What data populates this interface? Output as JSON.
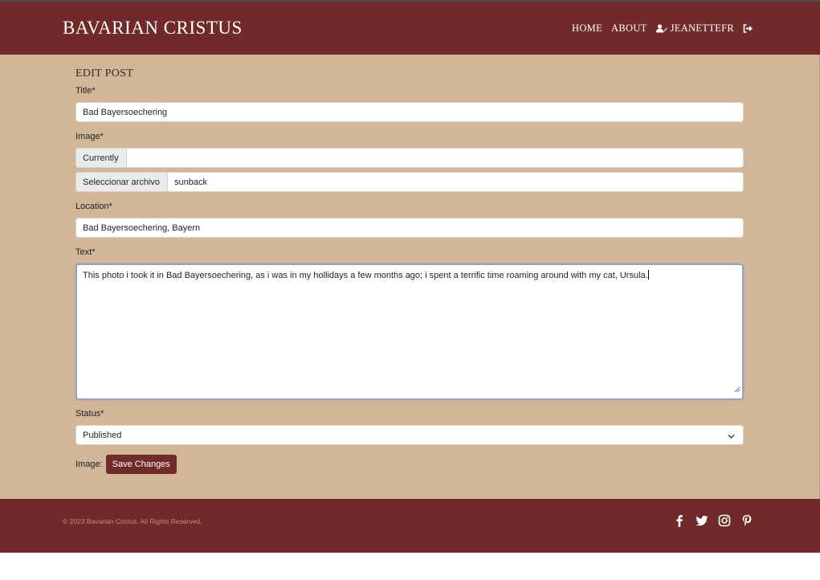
{
  "nav": {
    "brand": "BAVARIAN CRISTUS",
    "home": "HOME",
    "about": "ABOUT",
    "user": "JEANETTEFR",
    "icons": {
      "user": "user-edit-icon",
      "logout": "sign-out-icon"
    }
  },
  "form": {
    "heading": "EDIT POST",
    "title_label": "Title*",
    "title_value": "Bad Bayersoechering",
    "image_label": "Image*",
    "currently_label": "Currently",
    "currently_value": "",
    "file_button": "Seleccionar archivo",
    "file_value": "sunback",
    "location_label": "Location*",
    "location_value": "Bad Bayersoechering, Bayern",
    "text_label": "Text*",
    "text_value": "This photo i took it in Bad Bayersoechering, as i was in my hollidays a few months ago; i spent a terrific time roaming around with my cat, Ursula.",
    "status_label": "Status*",
    "status_value": "Published",
    "image_inline_label": "Image:",
    "save_button": "Save Changes"
  },
  "footer": {
    "copyright": "© 2023 Bavarian Cristus. All Rights Reserved.",
    "social": [
      "facebook-icon",
      "twitter-icon",
      "instagram-icon",
      "pinterest-icon"
    ]
  },
  "colors": {
    "brand_dark": "#712a2a",
    "page_bg": "#d2b698",
    "focus_border": "#93a5bd"
  }
}
